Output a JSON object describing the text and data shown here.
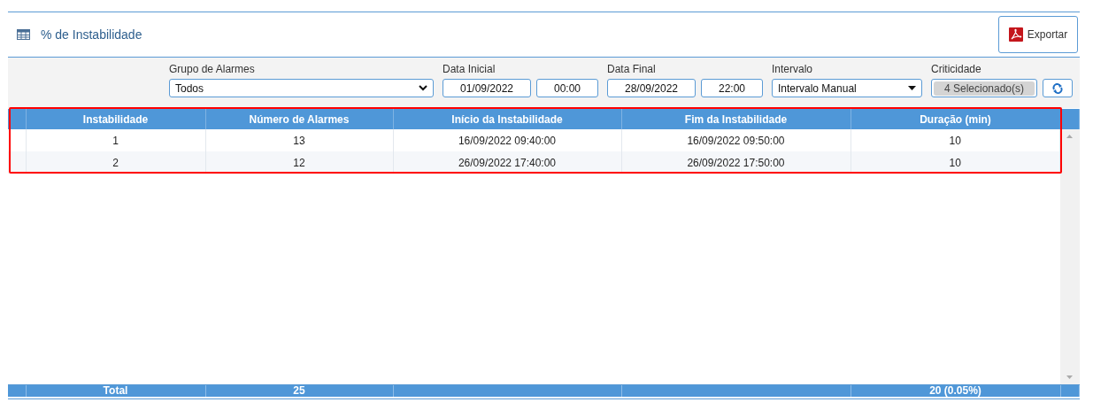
{
  "title": "% de Instabilidade",
  "export_button": {
    "label": "Exportar"
  },
  "filters": [
    {
      "label": "Grupo de Alarmes",
      "fields": [
        {
          "kind": "select",
          "value": "Todos"
        }
      ]
    },
    {
      "label": "Data Inicial",
      "fields": [
        {
          "kind": "date",
          "value": "01/09/2022"
        },
        {
          "kind": "time",
          "value": "00:00"
        }
      ]
    },
    {
      "label": "Data Final",
      "fields": [
        {
          "kind": "date",
          "value": "28/09/2022"
        },
        {
          "kind": "time",
          "value": "22:00"
        }
      ]
    },
    {
      "label": "Intervalo",
      "fields": [
        {
          "kind": "dropdown",
          "value": "Intervalo Manual"
        }
      ]
    },
    {
      "label": "Criticidade",
      "fields": [
        {
          "kind": "tags",
          "value": "4 Selecionado(s)"
        },
        {
          "kind": "refresh"
        }
      ]
    }
  ],
  "table": {
    "columns": [
      "Instabilidade",
      "Número de Alarmes",
      "Início da Instabilidade",
      "Fim da Instabilidade",
      "Duração (min)"
    ],
    "rows": [
      [
        "1",
        "13",
        "16/09/2022 09:40:00",
        "16/09/2022 09:50:00",
        "10"
      ],
      [
        "2",
        "12",
        "26/09/2022 17:40:00",
        "26/09/2022 17:50:00",
        "10"
      ]
    ],
    "totals": {
      "label": "Total",
      "alarm_count": "25",
      "duration": "20 (0.05%)"
    }
  }
}
